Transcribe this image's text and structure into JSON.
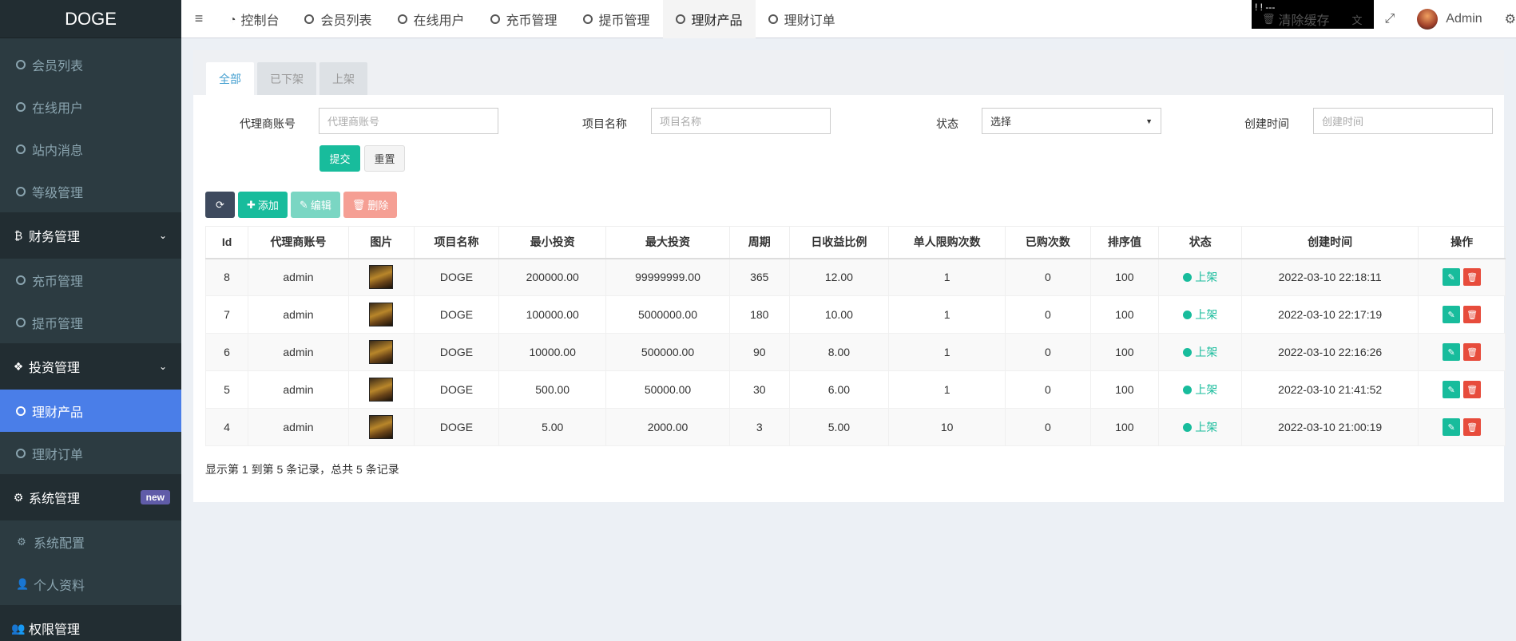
{
  "app": {
    "logo": "DOGE"
  },
  "sidebar": {
    "items": [
      {
        "type": "sub",
        "label": "会员列表",
        "active": false
      },
      {
        "type": "sub",
        "label": "在线用户",
        "active": false
      },
      {
        "type": "sub",
        "label": "站内消息",
        "active": false
      },
      {
        "type": "sub",
        "label": "等级管理",
        "active": false
      },
      {
        "type": "group",
        "label": "财务管理",
        "icon": "bitcoin-icon"
      },
      {
        "type": "sub",
        "label": "充币管理",
        "active": false
      },
      {
        "type": "sub",
        "label": "提币管理",
        "active": false
      },
      {
        "type": "group",
        "label": "投资管理",
        "icon": "cubes-icon"
      },
      {
        "type": "sub",
        "label": "理财产品",
        "active": true
      },
      {
        "type": "sub",
        "label": "理财订单",
        "active": false
      },
      {
        "type": "group",
        "label": "系统管理",
        "icon": "gears-icon",
        "badge": "new"
      },
      {
        "type": "sub",
        "label": "系统配置",
        "icon": "gear-icon"
      },
      {
        "type": "sub",
        "label": "个人资料",
        "icon": "user-icon"
      },
      {
        "type": "group",
        "label": "权限管理",
        "icon": "group-icon"
      }
    ]
  },
  "topbar": {
    "tabs": [
      {
        "label": "控制台",
        "icon": "dashboard-icon",
        "active": false
      },
      {
        "label": "会员列表",
        "active": false
      },
      {
        "label": "在线用户",
        "active": false
      },
      {
        "label": "充币管理",
        "active": false
      },
      {
        "label": "提币管理",
        "active": false
      },
      {
        "label": "理财产品",
        "active": true
      },
      {
        "label": "理财订单",
        "active": false
      }
    ],
    "blackbox_text": "! ! ---",
    "clear_cache": "清除缓存",
    "user": "Admin"
  },
  "content": {
    "tabs": [
      "全部",
      "已下架",
      "上架"
    ],
    "form": {
      "agent_label": "代理商账号",
      "agent_placeholder": "代理商账号",
      "name_label": "项目名称",
      "name_placeholder": "项目名称",
      "status_label": "状态",
      "status_value": "选择",
      "time_label": "创建时间",
      "time_placeholder": "创建时间",
      "submit": "提交",
      "reset": "重置"
    },
    "toolbar": {
      "add": "添加",
      "edit": "编辑",
      "delete": "删除"
    },
    "table": {
      "headers": [
        "Id",
        "代理商账号",
        "图片",
        "项目名称",
        "最小投资",
        "最大投资",
        "周期",
        "日收益比例",
        "单人限购次数",
        "已购次数",
        "排序值",
        "状态",
        "创建时间",
        "操作"
      ],
      "rows": [
        [
          "8",
          "admin",
          "",
          "DOGE",
          "200000.00",
          "99999999.00",
          "365",
          "12.00",
          "1",
          "0",
          "100",
          "上架",
          "2022-03-10 22:18:11"
        ],
        [
          "7",
          "admin",
          "",
          "DOGE",
          "100000.00",
          "5000000.00",
          "180",
          "10.00",
          "1",
          "0",
          "100",
          "上架",
          "2022-03-10 22:17:19"
        ],
        [
          "6",
          "admin",
          "",
          "DOGE",
          "10000.00",
          "500000.00",
          "90",
          "8.00",
          "1",
          "0",
          "100",
          "上架",
          "2022-03-10 22:16:26"
        ],
        [
          "5",
          "admin",
          "",
          "DOGE",
          "500.00",
          "50000.00",
          "30",
          "6.00",
          "1",
          "0",
          "100",
          "上架",
          "2022-03-10 21:41:52"
        ],
        [
          "4",
          "admin",
          "",
          "DOGE",
          "5.00",
          "2000.00",
          "3",
          "5.00",
          "10",
          "0",
          "100",
          "上架",
          "2022-03-10 21:00:19"
        ]
      ]
    },
    "pagination_text": "显示第 1 到第 5 条记录，总共 5 条记录"
  }
}
